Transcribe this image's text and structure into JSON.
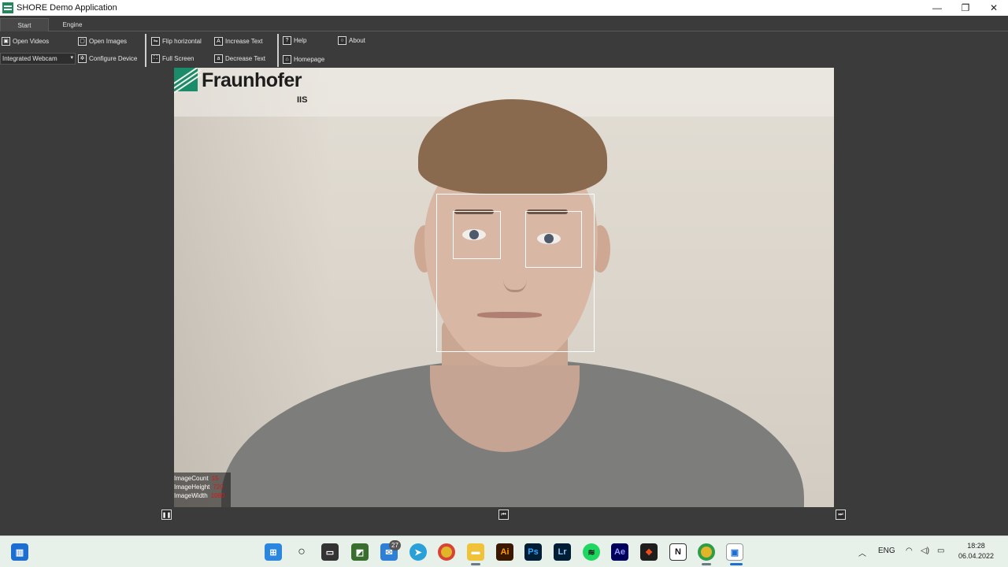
{
  "window": {
    "title": "SHORE Demo Application",
    "controls": {
      "minimize": "—",
      "restore": "❐",
      "close": "✕"
    }
  },
  "tabs": [
    "Start",
    "Engine"
  ],
  "ribbon": {
    "open_videos": "Open Videos",
    "open_images": "Open Images",
    "flip_horizontal": "Flip horizontal",
    "increase_text": "Increase Text",
    "help": "Help",
    "about": "About",
    "device_select": "Integrated Webcam",
    "configure_device": "Configure Device",
    "full_screen": "Full Screen",
    "decrease_text": "Decrease Text",
    "homepage": "Homepage"
  },
  "video": {
    "logo_name": "Fraunhofer",
    "logo_sub": "IIS",
    "stats": [
      {
        "label": "ImageCount",
        "value": "15"
      },
      {
        "label": "ImageHeight",
        "value": "720"
      },
      {
        "label": "ImageWidth",
        "value": "1080"
      }
    ]
  },
  "playback": {
    "pause": "❚❚",
    "prev": "⏮",
    "next": "⏭"
  },
  "taskbar": {
    "mail_badge": "27",
    "language": "ENG",
    "time": "18:28",
    "date": "06.04.2022",
    "apps": {
      "illustrator": "Ai",
      "photoshop": "Ps",
      "lightroom": "Lr",
      "after_effects": "Ae",
      "notion": "N"
    }
  },
  "colors": {
    "ui_background": "#3b3b3b",
    "fraunhofer_green": "#1a8c6a",
    "stat_value": "#d11a1a",
    "taskbar": "#e8f0ea"
  }
}
